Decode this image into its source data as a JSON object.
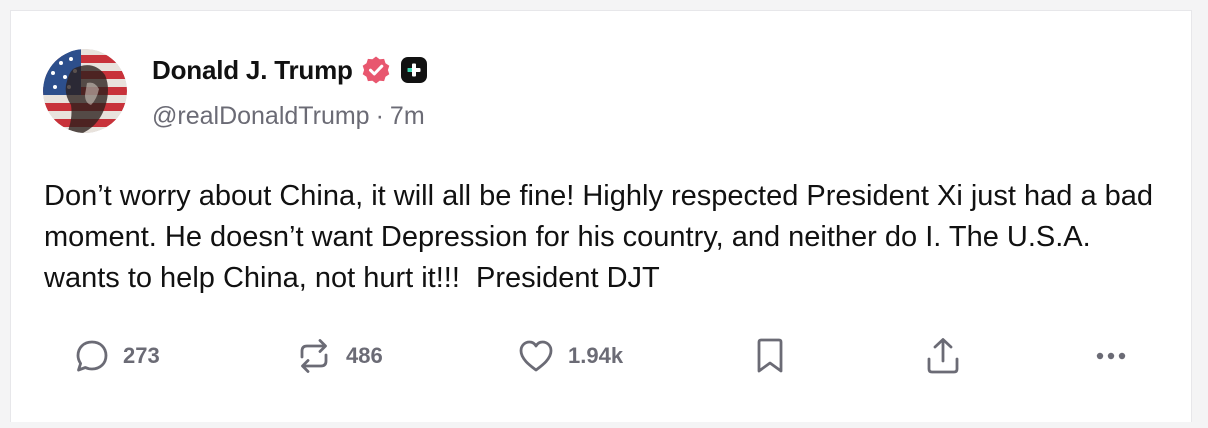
{
  "post": {
    "author": {
      "display_name": "Donald J. Trump",
      "handle": "@realDonaldTrump",
      "verified_icon": "verified-badge-icon",
      "plus_icon": "plus-badge-icon"
    },
    "separator": "·",
    "time_ago": "7m",
    "text": "Don’t worry about China, it will all be fine! Highly respected President Xi just had a bad moment. He doesn’t want Depression for his country, and neither do I. The U.S.A. wants to help China, not hurt it!!!  President DJT",
    "actions": {
      "reply_count": "273",
      "repost_count": "486",
      "like_count": "1.94k"
    }
  },
  "colors": {
    "verified": "#e8576f",
    "text_primary": "#111111",
    "text_secondary": "#6b6b75",
    "icon": "#6b6b75"
  }
}
